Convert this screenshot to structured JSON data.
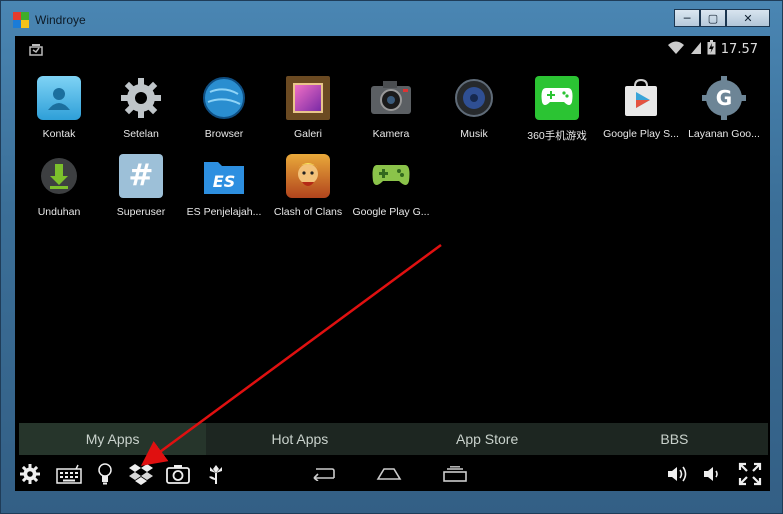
{
  "window": {
    "title": "Windroye",
    "minimize_label": "─",
    "maximize_label": "▢",
    "close_label": "✕"
  },
  "statusbar": {
    "time": "17.57"
  },
  "apps": [
    {
      "label": "Kontak",
      "icon": "contacts-icon"
    },
    {
      "label": "Setelan",
      "icon": "settings-gear-icon"
    },
    {
      "label": "Browser",
      "icon": "globe-icon"
    },
    {
      "label": "Galeri",
      "icon": "gallery-icon"
    },
    {
      "label": "Kamera",
      "icon": "camera-icon"
    },
    {
      "label": "Musik",
      "icon": "music-speaker-icon"
    },
    {
      "label": "360手机游戏",
      "icon": "gamepad-icon"
    },
    {
      "label": "Google Play S...",
      "icon": "play-store-icon"
    },
    {
      "label": "Layanan Goo...",
      "icon": "google-services-icon"
    },
    {
      "label": "Unduhan",
      "icon": "download-icon"
    },
    {
      "label": "Superuser",
      "icon": "superuser-icon"
    },
    {
      "label": "ES Penjelajah...",
      "icon": "es-file-explorer-icon"
    },
    {
      "label": "Clash of Clans",
      "icon": "clash-of-clans-icon"
    },
    {
      "label": "Google Play G...",
      "icon": "play-games-icon"
    }
  ],
  "tabs": [
    {
      "label": "My Apps",
      "active": true
    },
    {
      "label": "Hot Apps",
      "active": false
    },
    {
      "label": "App Store",
      "active": false
    },
    {
      "label": "BBS",
      "active": false
    }
  ],
  "navbar": {
    "left": [
      "gear-icon",
      "keyboard-icon",
      "lightbulb-icon",
      "dropbox-icon",
      "camera-icon",
      "flower-icon"
    ],
    "center": [
      "back-icon",
      "home-icon",
      "recent-apps-icon"
    ],
    "right": [
      "volume-up-icon",
      "volume-down-icon",
      "fullscreen-icon"
    ]
  },
  "colors": {
    "arrow": "#e01010",
    "tab_active_bg": "#26352b",
    "tab_bg": "#1d2621"
  }
}
